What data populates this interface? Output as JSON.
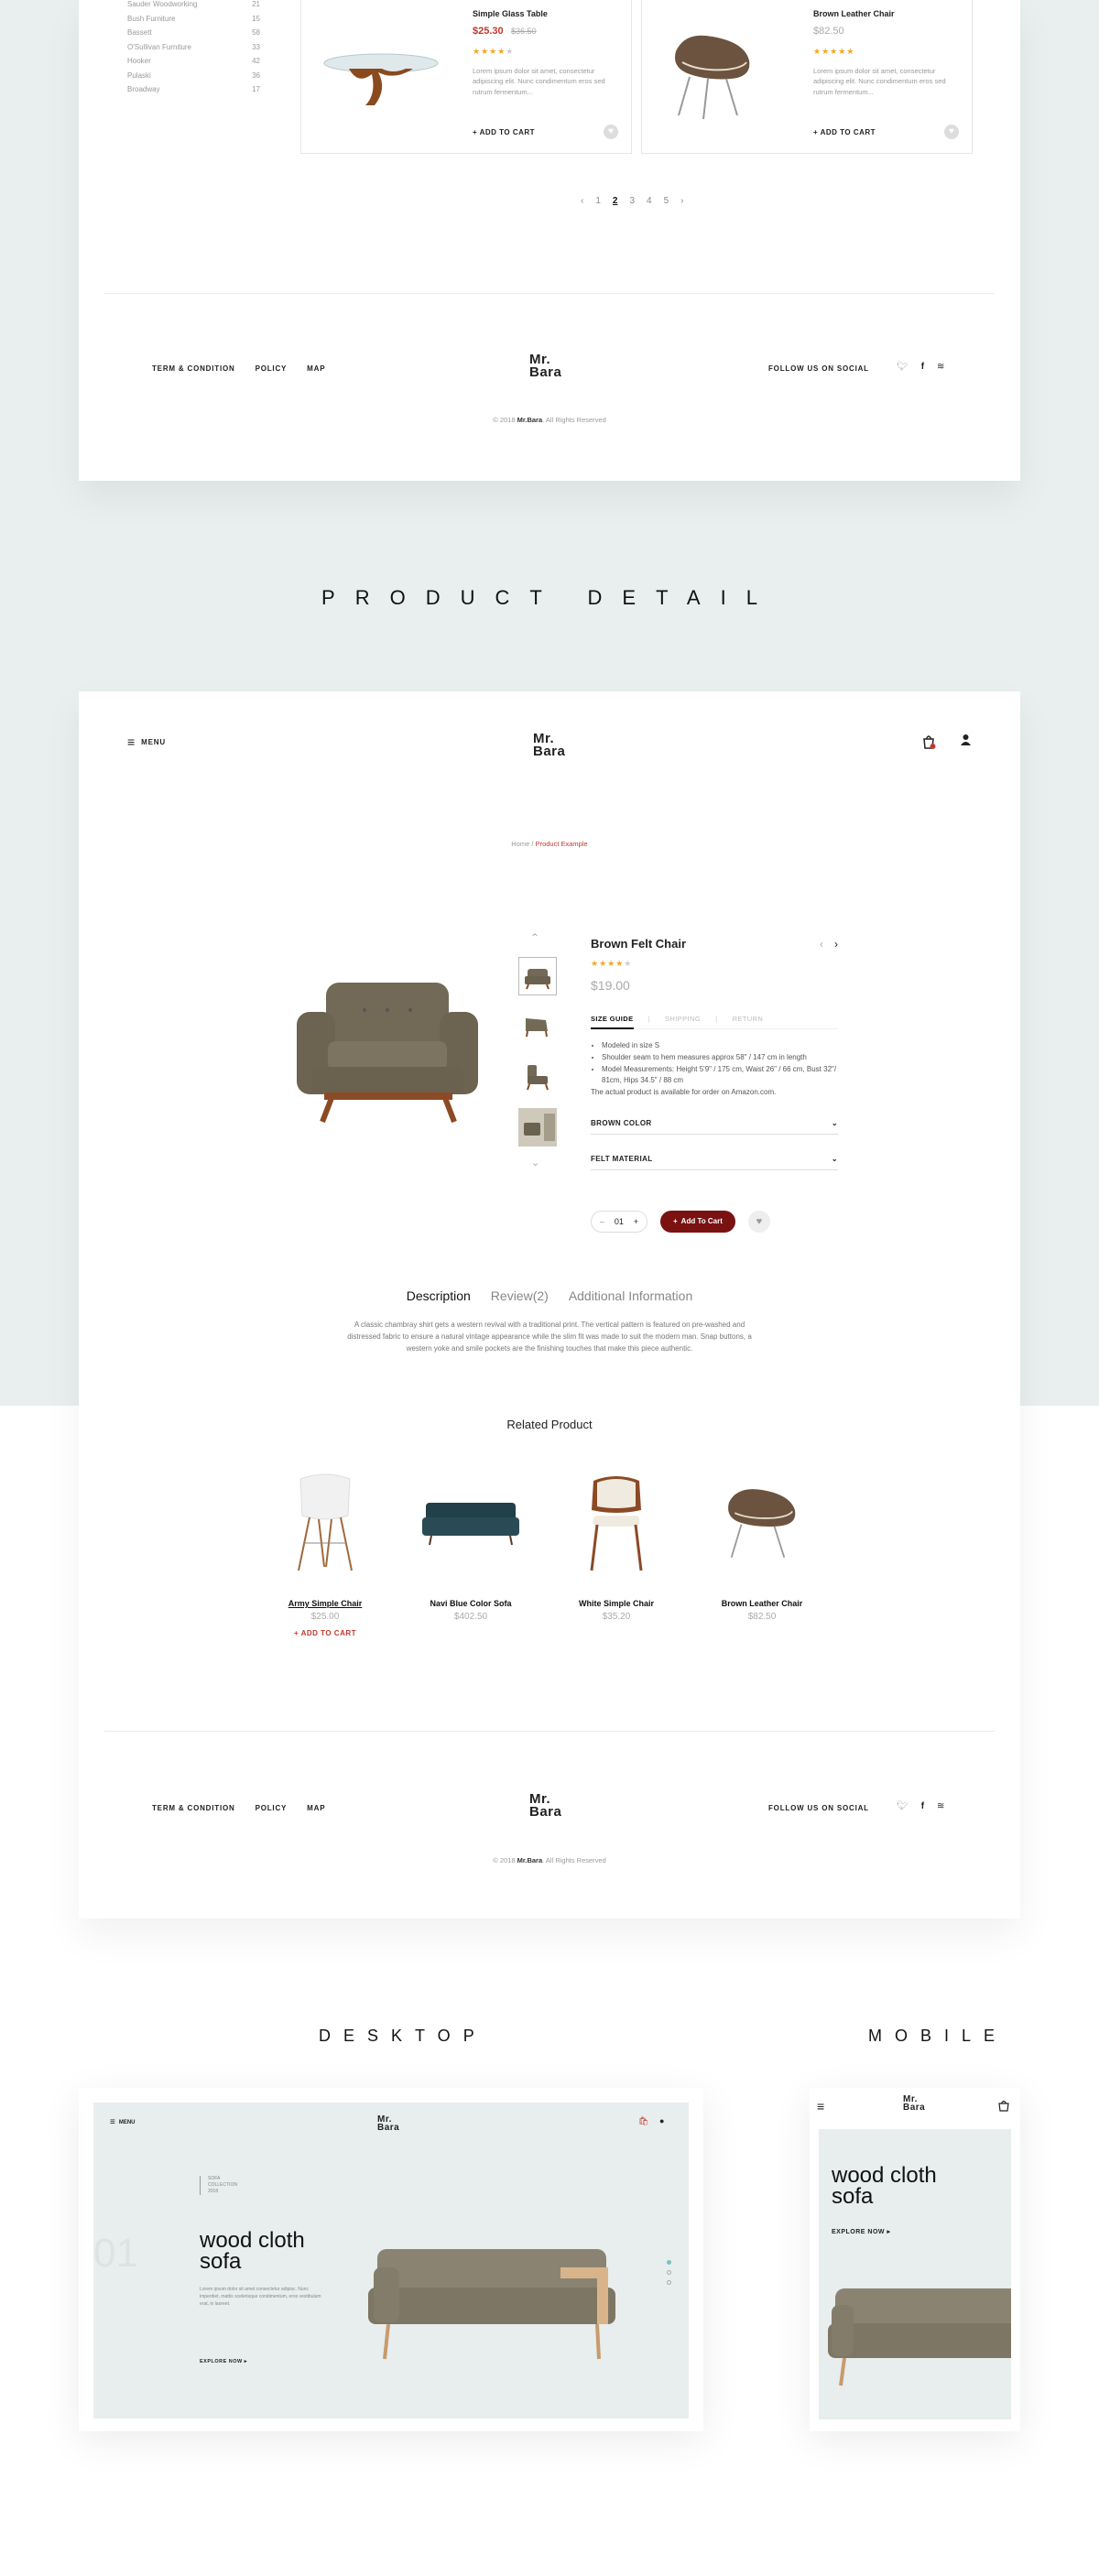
{
  "shop": {
    "categories": [
      {
        "name": "Sauder Woodworking",
        "count": "21"
      },
      {
        "name": "Bush Furniture",
        "count": "15"
      },
      {
        "name": "Bassett",
        "count": "58"
      },
      {
        "name": "O'Sullivan Furniture",
        "count": "33"
      },
      {
        "name": "Hooker",
        "count": "42"
      },
      {
        "name": "Pulaski",
        "count": "36"
      },
      {
        "name": "Broadway",
        "count": "17"
      }
    ],
    "products": [
      {
        "name": "Simple Glass Table",
        "price": "$25.30",
        "old_price": "$36.50",
        "rating": 4,
        "desc": "Lorem ipsum dolor sit amet, consectetur adipiscing elit. Nunc condimentum eros sed rutrum fermentum...",
        "cta": "ADD TO CART"
      },
      {
        "name": "Brown Leather Chair",
        "price": "$82.50",
        "rating": 5,
        "desc": "Lorem ipsum dolor sit amet, consectetur adipiscing elit. Nunc condimentum eros sed rutrum fermentum...",
        "cta": "ADD TO CART"
      }
    ],
    "pagination": {
      "prev": "‹",
      "pages": [
        "1",
        "2",
        "3",
        "4",
        "5"
      ],
      "active": "2",
      "next": "›"
    }
  },
  "footer": {
    "links": [
      "TERM & CONDITION",
      "POLICY",
      "MAP"
    ],
    "logo_line1": "Mr.",
    "logo_line2": "Bara",
    "social_label": "FOLLOW US ON SOCIAL",
    "copyright_pre": "© 2018",
    "copyright_brand": "Mr.Bara",
    "copyright_post": ". All Rights Reserved"
  },
  "section_product_detail": "PRODUCT DETAIL",
  "header": {
    "menu_label": "MENU",
    "logo_line1": "Mr.",
    "logo_line2": "Bara"
  },
  "breadcrumb": {
    "home": "Home",
    "sep": " / ",
    "current": "Product Example"
  },
  "product": {
    "name": "Brown Felt Chair",
    "rating": 4,
    "price": "$19.00",
    "tabs": [
      "SIZE GUIDE",
      "SHIPPING",
      "RETURN"
    ],
    "active_tab": "SIZE GUIDE",
    "bullets": [
      "Modeled in size S",
      "Shoulder seam to hem measures approx 58\" / 147 cm in length",
      "Model Measurements: Height 5'9\" / 175 cm, Waist 26\" / 66 cm, Bust 32\"/ 81cm, Hips 34.5\" / 88 cm"
    ],
    "note": "The actual product is available for order on Amazon.com.",
    "options": [
      "BROWN COLOR",
      "FELT MATERIAL"
    ],
    "quantity": "01",
    "add_to_cart": "Add To Cart"
  },
  "details_tabs": {
    "items": [
      "Description",
      "Review(2)",
      "Additional Information"
    ],
    "active": "Description"
  },
  "description": "A classic chambray shirt gets a western revival with a traditional print. The vertical pattern is featured on pre-washed and distressed fabric to ensure a natural vintage appearance while the slim fit was made to suit the modern man. Snap buttons, a western yoke and smile pockets are the finishing touches that make this piece authentic.",
  "related": {
    "title": "Related Product",
    "items": [
      {
        "name": "Army Simple Chair",
        "price": "$25.00",
        "cta": "ADD TO CART"
      },
      {
        "name": "Navi Blue Color Sofa",
        "price": "$402.50"
      },
      {
        "name": "White Simple Chair",
        "price": "$35.20"
      },
      {
        "name": "Brown Leather Chair",
        "price": "$82.50"
      }
    ]
  },
  "desktop_label": "DESKTOP",
  "mobile_label": "MOBILE",
  "desktop_preview": {
    "menu_label": "MENU",
    "logo_line1": "Mr.",
    "logo_line2": "Bara",
    "tag_lines": [
      "SOFA",
      "COLLECTION",
      "2018"
    ],
    "number": "01",
    "hero_line1": "wood cloth",
    "hero_line2": "sofa",
    "hero_desc": "Lorem ipsum dolor sit amet consectetur adipisc. Nunc imperdiet, mattis scelerisque condimentum, eros vestibulum erat, in laoreet.",
    "cta": "EXPLORE NOW"
  },
  "mobile_preview": {
    "logo_line1": "Mr.",
    "logo_line2": "Bara",
    "hero_line1": "wood cloth",
    "hero_line2": "sofa",
    "cta": "EXPLORE NOW"
  },
  "colors": {
    "accent_red": "#c0392b",
    "dark_red": "#7a1212",
    "star": "#f5a623",
    "bg": "#e9eeee"
  }
}
